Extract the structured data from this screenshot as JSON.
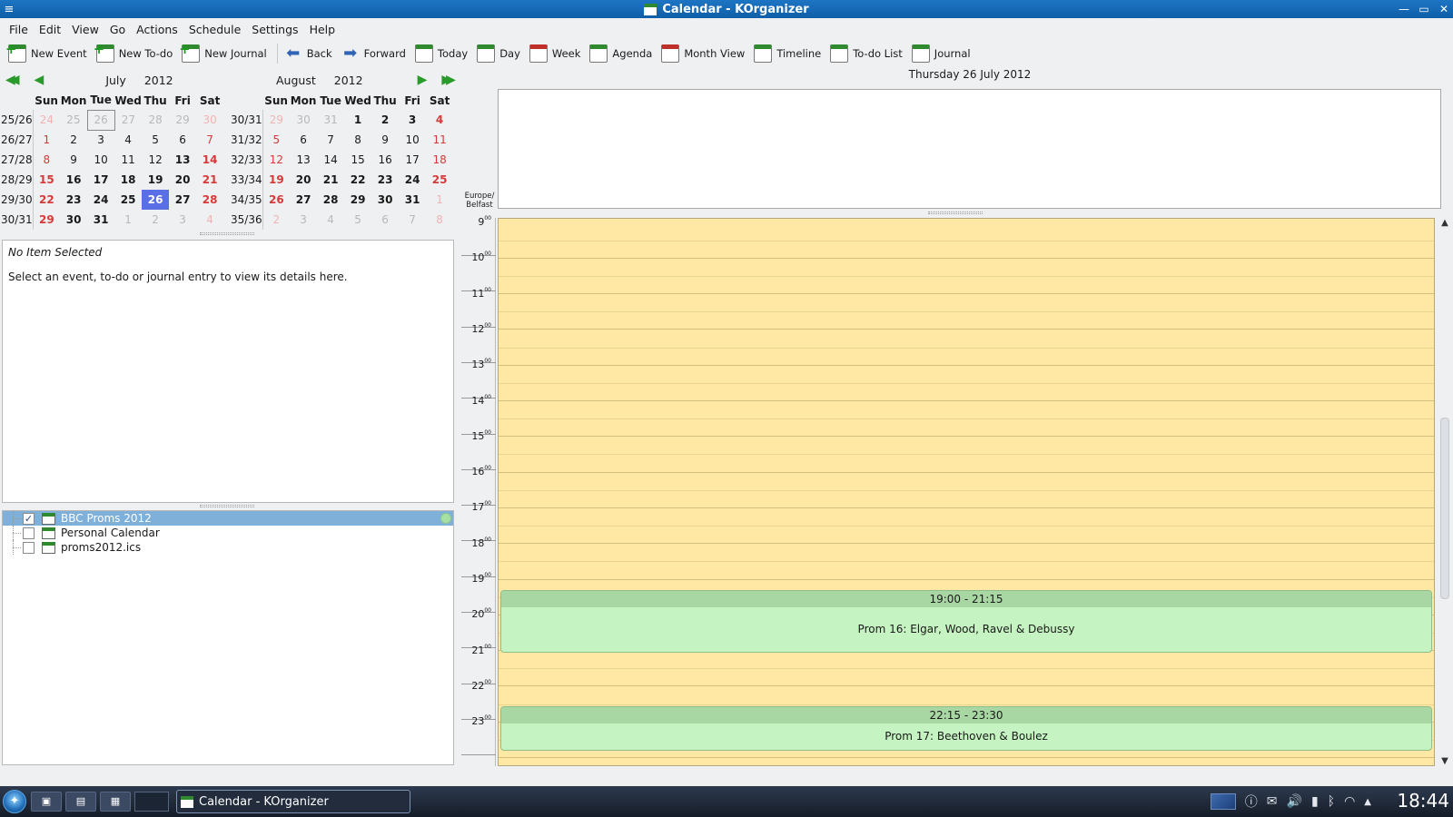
{
  "window": {
    "title": "Calendar - KOrganizer",
    "menu_glyph": "≡",
    "controls": {
      "minimize": "—",
      "maximize": "▭",
      "close": "✕"
    }
  },
  "menu": [
    "File",
    "Edit",
    "View",
    "Go",
    "Actions",
    "Schedule",
    "Settings",
    "Help"
  ],
  "toolbar": [
    {
      "label": "New Event",
      "icon": "new-event-icon"
    },
    {
      "label": "New To-do",
      "icon": "new-todo-icon"
    },
    {
      "label": "New Journal",
      "icon": "new-journal-icon"
    },
    {
      "label": "Back",
      "icon": "back-arrow-icon"
    },
    {
      "label": "Forward",
      "icon": "forward-arrow-icon"
    },
    {
      "label": "Today",
      "icon": "today-icon"
    },
    {
      "label": "Day",
      "icon": "day-view-icon"
    },
    {
      "label": "Week",
      "icon": "week-view-icon"
    },
    {
      "label": "Agenda",
      "icon": "agenda-icon"
    },
    {
      "label": "Month View",
      "icon": "month-view-icon"
    },
    {
      "label": "Timeline",
      "icon": "timeline-icon"
    },
    {
      "label": "To-do List",
      "icon": "todo-list-icon"
    },
    {
      "label": "Journal",
      "icon": "journal-icon"
    }
  ],
  "datenav": {
    "left_month": "July",
    "left_year": "2012",
    "right_month": "August",
    "right_year": "2012",
    "prev_year": "◀◀",
    "prev_month": "◀",
    "next_month": "▶",
    "next_year": "▶▶"
  },
  "weekday_headers": [
    "Sun",
    "Mon",
    "Tue",
    "Wed",
    "Thu",
    "Fri",
    "Sat"
  ],
  "july": [
    {
      "wk": "25/26",
      "days": [
        "24",
        "25",
        "26",
        "27",
        "28",
        "29",
        "30"
      ]
    },
    {
      "wk": "26/27",
      "days": [
        "1",
        "2",
        "3",
        "4",
        "5",
        "6",
        "7"
      ]
    },
    {
      "wk": "27/28",
      "days": [
        "8",
        "9",
        "10",
        "11",
        "12",
        "13",
        "14"
      ]
    },
    {
      "wk": "28/29",
      "days": [
        "15",
        "16",
        "17",
        "18",
        "19",
        "20",
        "21"
      ]
    },
    {
      "wk": "29/30",
      "days": [
        "22",
        "23",
        "24",
        "25",
        "26",
        "27",
        "28"
      ]
    },
    {
      "wk": "30/31",
      "days": [
        "29",
        "30",
        "31",
        "1",
        "2",
        "3",
        "4"
      ]
    }
  ],
  "august": [
    {
      "wk": "30/31",
      "days": [
        "29",
        "30",
        "31",
        "1",
        "2",
        "3",
        "4"
      ]
    },
    {
      "wk": "31/32",
      "days": [
        "5",
        "6",
        "7",
        "8",
        "9",
        "10",
        "11"
      ]
    },
    {
      "wk": "32/33",
      "days": [
        "12",
        "13",
        "14",
        "15",
        "16",
        "17",
        "18"
      ]
    },
    {
      "wk": "33/34",
      "days": [
        "19",
        "20",
        "21",
        "22",
        "23",
        "24",
        "25"
      ]
    },
    {
      "wk": "34/35",
      "days": [
        "26",
        "27",
        "28",
        "29",
        "30",
        "31",
        "1"
      ]
    },
    {
      "wk": "35/36",
      "days": [
        "2",
        "3",
        "4",
        "5",
        "6",
        "7",
        "8"
      ]
    }
  ],
  "selected_day": "26",
  "info": {
    "heading": "No Item Selected",
    "text": "Select an event, to-do or journal entry to view its details here."
  },
  "calendars": [
    {
      "name": "BBC Proms 2012",
      "checked": true,
      "selected": true,
      "check_glyph": "✓"
    },
    {
      "name": "Personal Calendar",
      "checked": false,
      "selected": false
    },
    {
      "name": "proms2012.ics",
      "checked": false,
      "selected": false
    }
  ],
  "agenda": {
    "date": "Thursday 26 July 2012",
    "timezone_line1": "Europe/",
    "timezone_line2": "Belfast",
    "hours": [
      "9",
      "10",
      "11",
      "12",
      "13",
      "14",
      "15",
      "16",
      "17",
      "18",
      "19",
      "20",
      "21",
      "22",
      "23"
    ],
    "minutes_suffix": "00",
    "events": [
      {
        "time": "19:00 - 21:15",
        "title": "Prom 16: Elgar, Wood, Ravel & Debussy",
        "start": 19.0,
        "end": 20.75
      },
      {
        "time": "22:15 - 23:30",
        "title": "Prom 17: Beethoven & Boulez",
        "start": 22.25,
        "end": 23.5
      }
    ],
    "scroll_up": "▲",
    "scroll_down": "▼"
  },
  "taskbar": {
    "task_label": "Calendar - KOrganizer",
    "clock": "18:44",
    "tray_icons": [
      "network-icon",
      "info-icon",
      "mail-icon",
      "volume-icon",
      "battery-icon",
      "bluetooth-icon",
      "wifi-icon",
      "tray-expand-icon"
    ],
    "tray_glyphs": {
      "info": "ⓘ",
      "mail": "✉",
      "volume": "🔊",
      "battery": "▮",
      "bluetooth": "ᛒ",
      "wifi": "◠",
      "expand": "▲"
    }
  },
  "colors": {
    "agenda_bg": "#ffe8a3",
    "event_bg": "#c6f3c2",
    "event_header": "#a8d7a4",
    "selected_day": "#5a6ee6",
    "weekend_red": "#d63a3a",
    "titlebar": "#1d75c3"
  }
}
